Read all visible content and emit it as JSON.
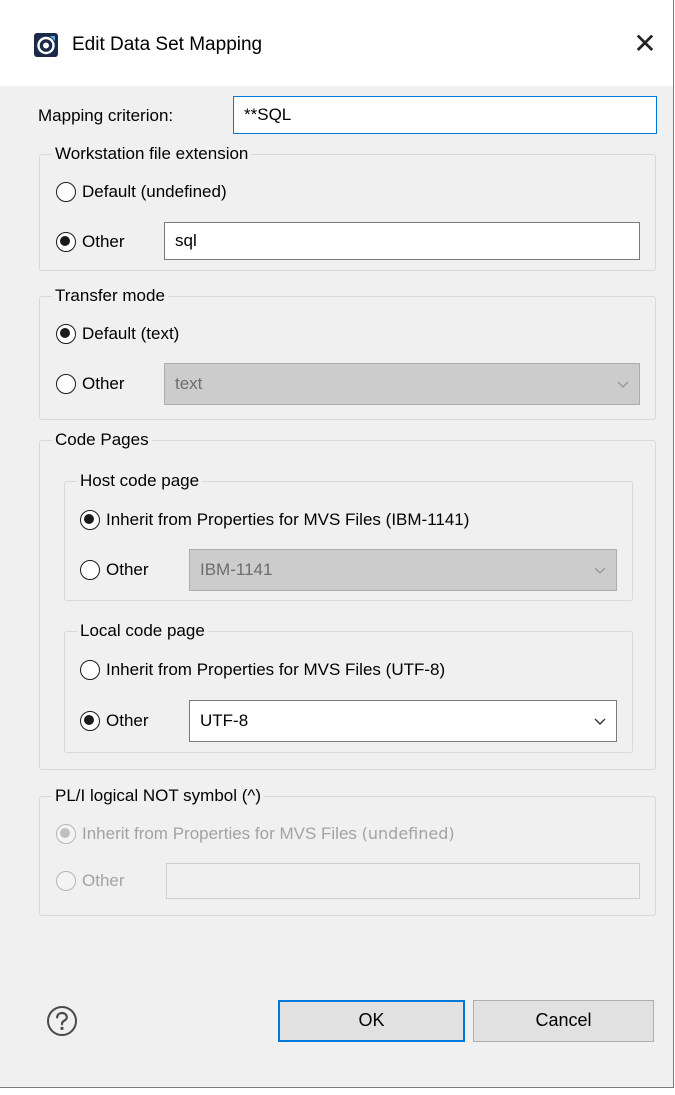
{
  "window": {
    "title": "Edit Data Set Mapping",
    "app_icon": "eclipse-app-icon",
    "close_icon": "close-icon",
    "close_glyph": "✕"
  },
  "mapping": {
    "label": "Mapping criterion:",
    "value": "**SQL"
  },
  "workstation_ext": {
    "legend": "Workstation file extension",
    "default_label": "Default",
    "default_hint": "(undefined)",
    "other_label": "Other",
    "other_value": "sql",
    "selected": "other"
  },
  "transfer_mode": {
    "legend": "Transfer mode",
    "default_label": "Default",
    "default_hint": "(text)",
    "other_label": "Other",
    "other_value": "text",
    "selected": "default"
  },
  "code_pages": {
    "legend": "Code Pages",
    "host": {
      "legend": "Host code page",
      "inherit_label": "Inherit from Properties for MVS Files",
      "inherit_hint": "(IBM-1141)",
      "other_label": "Other",
      "other_value": "IBM-1141",
      "selected": "inherit"
    },
    "local": {
      "legend": "Local code page",
      "inherit_label": "Inherit from Properties for MVS Files",
      "inherit_hint": "(UTF-8)",
      "other_label": "Other",
      "other_value": "UTF-8",
      "selected": "other"
    }
  },
  "pli_not": {
    "legend": "PL/I logical NOT symbol (^)",
    "inherit_label": "Inherit from Properties for MVS Files",
    "inherit_hint": "(undefined)",
    "other_label": "Other",
    "other_value": "",
    "selected": "inherit",
    "enabled": false
  },
  "footer": {
    "help_icon": "help-icon",
    "ok_label": "OK",
    "cancel_label": "Cancel"
  },
  "colors": {
    "focus_accent": "#0078d7",
    "dialog_bg": "#f0f0f0",
    "disabled_combo_bg": "#cccccc"
  }
}
